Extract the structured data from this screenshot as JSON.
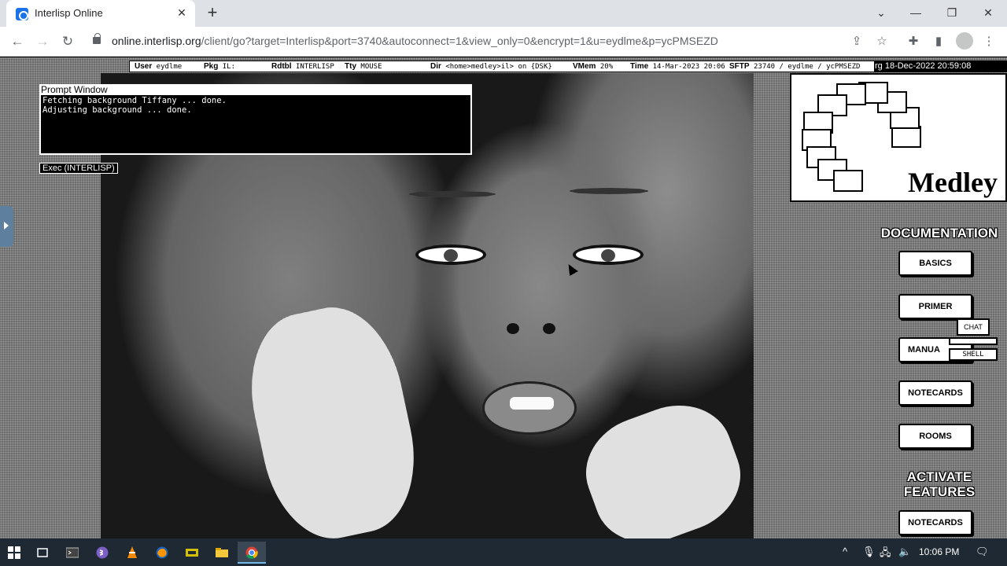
{
  "browser": {
    "tab_title": "Interlisp Online",
    "tab_close": "✕",
    "new_tab": "+",
    "url_host": "online.interlisp.org",
    "url_path": "/client/go?target=Interlisp&port=3740&autoconnect=1&view_only=0&encrypt=1&u=eydlme&p=ycPMSEZD",
    "icons": [
      "back-icon",
      "forward-icon",
      "reload-icon",
      "lock-icon",
      "share-icon",
      "star-icon",
      "extensions-icon",
      "sidepanel-icon",
      "profile-icon",
      "menu-icon"
    ]
  },
  "statusbar": {
    "user_label": "User",
    "user_value": "eydlme",
    "pkg_label": "Pkg",
    "pkg_value": "IL:",
    "rdtbl_label": "Rdtbl",
    "rdtbl_value": "INTERLISP",
    "tty_label": "Tty",
    "tty_value": "MOUSE",
    "dir_label": "Dir",
    "dir_value": "<home>medley>il> on {DSK}",
    "vmem_label": "VMem",
    "vmem_value": "20%",
    "time_label": "Time",
    "time_value": "14-Mar-2023 20:06",
    "sftp_label": "SFTP",
    "sftp_value": "23740 / eydlme / ycPMSEZD"
  },
  "clock": "rg 18-Dec-2022 20:59:08",
  "prompt_window": {
    "title": "Prompt Window",
    "lines": [
      "Fetching background Tiffany ... done.",
      "Adjusting background ... done."
    ]
  },
  "exec_label": "Exec (INTERLISP)",
  "logo_text": "Medley",
  "documentation": {
    "heading": "DOCUMENTATION",
    "buttons": [
      "BASICS",
      "PRIMER",
      "MANUA",
      "NOTECARDS",
      "ROOMS"
    ]
  },
  "features": {
    "heading_line1": "ACTIVATE",
    "heading_line2": "FEATURES",
    "buttons": [
      "NOTECARDS"
    ]
  },
  "chat_widget": {
    "screen": "CHAT",
    "label": "SHELL"
  },
  "taskbar": {
    "time": "10:06 PM",
    "apps": [
      "start-icon",
      "task-view-icon",
      "terminal-icon",
      "emacs-icon",
      "vlc-icon",
      "firefox-icon",
      "notepad-icon",
      "file-explorer-icon",
      "chrome-icon"
    ]
  }
}
